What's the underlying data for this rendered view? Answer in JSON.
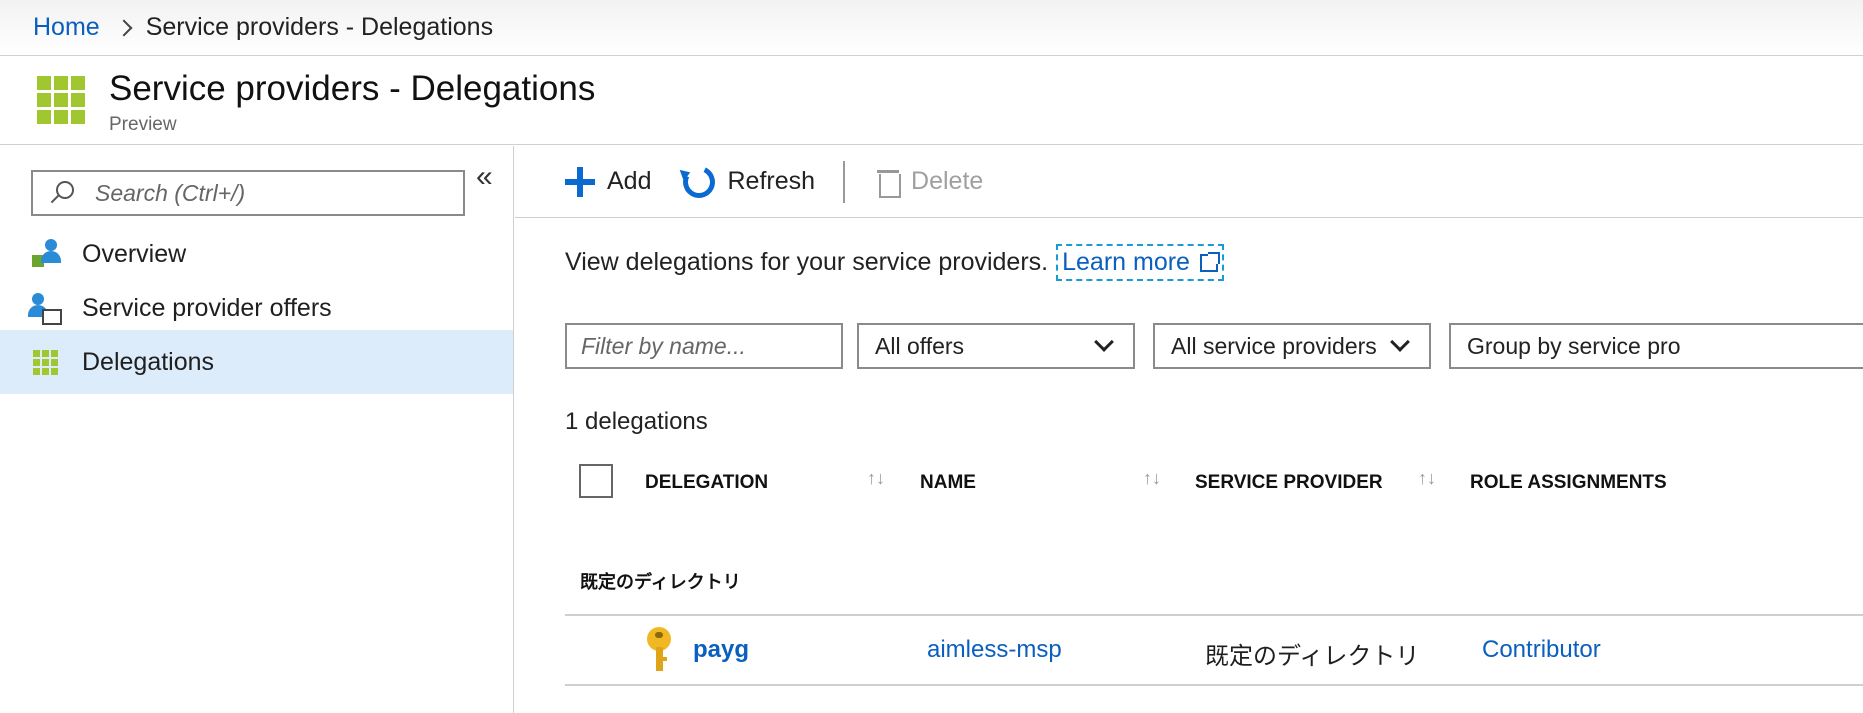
{
  "breadcrumb": {
    "home": "Home",
    "current": "Service providers - Delegations"
  },
  "header": {
    "title": "Service providers - Delegations",
    "subtitle": "Preview"
  },
  "sidebar": {
    "search_placeholder": "Search (Ctrl+/)",
    "collapse_glyph": "«",
    "items": [
      {
        "label": "Overview",
        "icon": "overview-icon",
        "selected": false
      },
      {
        "label": "Service provider offers",
        "icon": "service-provider-offers-icon",
        "selected": false
      },
      {
        "label": "Delegations",
        "icon": "delegations-icon",
        "selected": true
      }
    ]
  },
  "toolbar": {
    "add_label": "Add",
    "refresh_label": "Refresh",
    "delete_label": "Delete"
  },
  "intro": {
    "text": "View delegations for your service providers.",
    "learn_more": "Learn more"
  },
  "filters": {
    "name_placeholder": "Filter by name...",
    "offers_value": "All offers",
    "providers_value": "All service providers",
    "group_value": "Group by service pro"
  },
  "table": {
    "count_label": "1 delegations",
    "columns": [
      "DELEGATION",
      "NAME",
      "SERVICE PROVIDER",
      "ROLE ASSIGNMENTS"
    ],
    "sort_glyph": "↑↓",
    "group_label": "既定のディレクトリ",
    "rows": [
      {
        "delegation": "payg",
        "name": "aimless-msp",
        "service_provider": "既定のディレクトリ",
        "role_assignments": "Contributor"
      }
    ]
  },
  "colors": {
    "accent": "#0b6ad1",
    "link": "#0b5fbf",
    "selected_bg": "#dcecfb",
    "logo_green": "#a0c630"
  }
}
